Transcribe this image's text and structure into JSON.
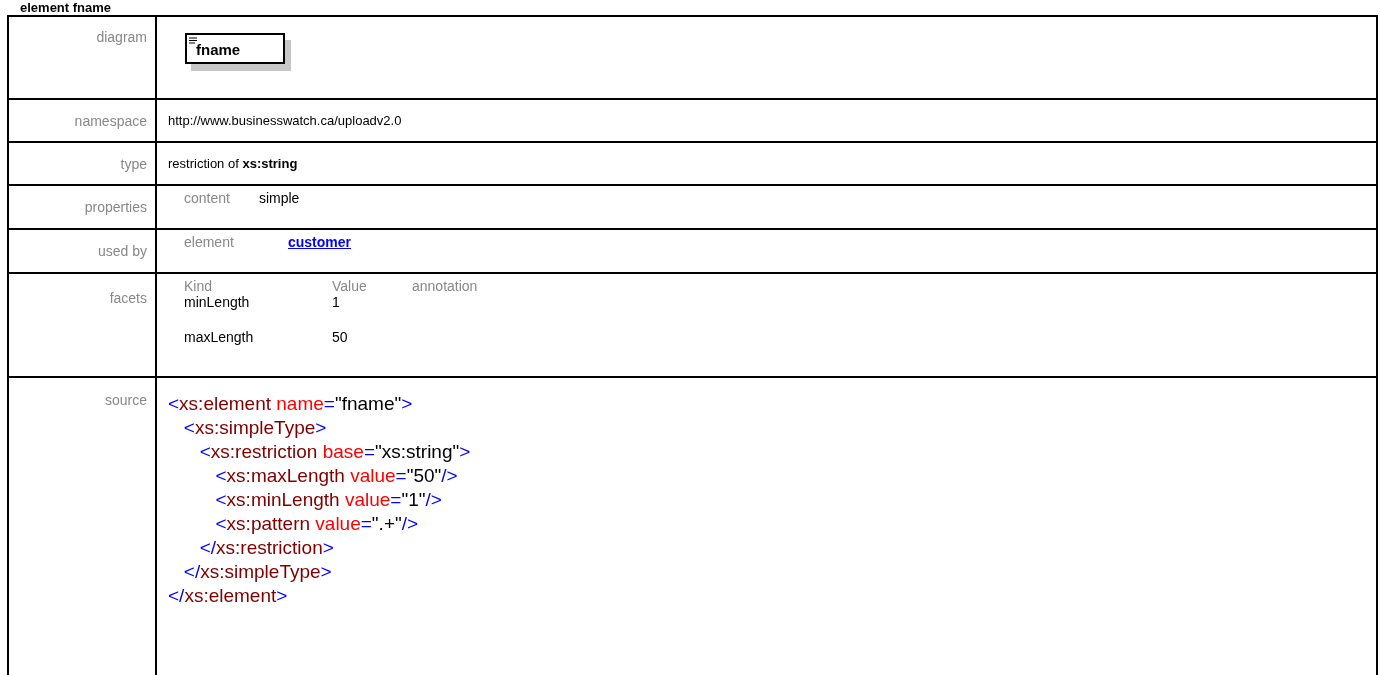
{
  "heading": "element fname",
  "diagram": {
    "label": "diagram",
    "node": "fname"
  },
  "namespace": {
    "label": "namespace",
    "value": "http://www.businesswatch.ca/uploadv2.0"
  },
  "type": {
    "label": "type",
    "value": "restriction of **xs:string**"
  },
  "properties": {
    "label": "properties",
    "items": [
      {
        "key": "content",
        "value": "simple"
      }
    ]
  },
  "used_by": {
    "label": "used by",
    "items": [
      {
        "key": "element",
        "link": "customer"
      }
    ]
  },
  "facets": {
    "label": "facets",
    "columns": [
      "Kind",
      "Value",
      "annotation"
    ],
    "rows": [
      {
        "kind": "minLength",
        "value": "1"
      },
      {
        "kind": "maxLength",
        "value": "50"
      }
    ]
  },
  "source": {
    "label": "source",
    "lines": [
      {
        "tokens": [
          {
            "kind": "punct",
            "text": "<"
          },
          {
            "kind": "tag",
            "text": "xs:element"
          },
          {
            "kind": "attr",
            "text": " name"
          },
          {
            "kind": "punct",
            "text": "="
          },
          {
            "kind": "value",
            "text": "\"fname\""
          },
          {
            "kind": "punct",
            "text": ">"
          }
        ]
      },
      {
        "tokens": [
          {
            "kind": "punct",
            "text": "   <"
          },
          {
            "kind": "tag",
            "text": "xs:simpleType"
          },
          {
            "kind": "punct",
            "text": ">"
          }
        ]
      },
      {
        "tokens": [
          {
            "kind": "punct",
            "text": "      <"
          },
          {
            "kind": "tag",
            "text": "xs:restriction"
          },
          {
            "kind": "attr",
            "text": " base"
          },
          {
            "kind": "punct",
            "text": "="
          },
          {
            "kind": "value",
            "text": "\"xs:string\""
          },
          {
            "kind": "punct",
            "text": ">"
          }
        ]
      },
      {
        "tokens": [
          {
            "kind": "punct",
            "text": "         <"
          },
          {
            "kind": "tag",
            "text": "xs:maxLength"
          },
          {
            "kind": "attr",
            "text": " value"
          },
          {
            "kind": "punct",
            "text": "="
          },
          {
            "kind": "value",
            "text": "\"50\""
          },
          {
            "kind": "punct",
            "text": "/>"
          }
        ]
      },
      {
        "tokens": [
          {
            "kind": "punct",
            "text": "         <"
          },
          {
            "kind": "tag",
            "text": "xs:minLength"
          },
          {
            "kind": "attr",
            "text": " value"
          },
          {
            "kind": "punct",
            "text": "="
          },
          {
            "kind": "value",
            "text": "\"1\""
          },
          {
            "kind": "punct",
            "text": "/>"
          }
        ]
      },
      {
        "tokens": [
          {
            "kind": "punct",
            "text": "         <"
          },
          {
            "kind": "tag",
            "text": "xs:pattern"
          },
          {
            "kind": "attr",
            "text": " value"
          },
          {
            "kind": "punct",
            "text": "="
          },
          {
            "kind": "value",
            "text": "\".+\""
          },
          {
            "kind": "punct",
            "text": "/>"
          }
        ]
      },
      {
        "tokens": [
          {
            "kind": "punct",
            "text": "      </"
          },
          {
            "kind": "tag",
            "text": "xs:restriction"
          },
          {
            "kind": "punct",
            "text": ">"
          }
        ]
      },
      {
        "tokens": [
          {
            "kind": "punct",
            "text": "   </"
          },
          {
            "kind": "tag",
            "text": "xs:simpleType"
          },
          {
            "kind": "punct",
            "text": ">"
          }
        ]
      },
      {
        "tokens": [
          {
            "kind": "punct",
            "text": "</"
          },
          {
            "kind": "tag",
            "text": "xs:element"
          },
          {
            "kind": "punct",
            "text": ">"
          }
        ]
      }
    ]
  }
}
